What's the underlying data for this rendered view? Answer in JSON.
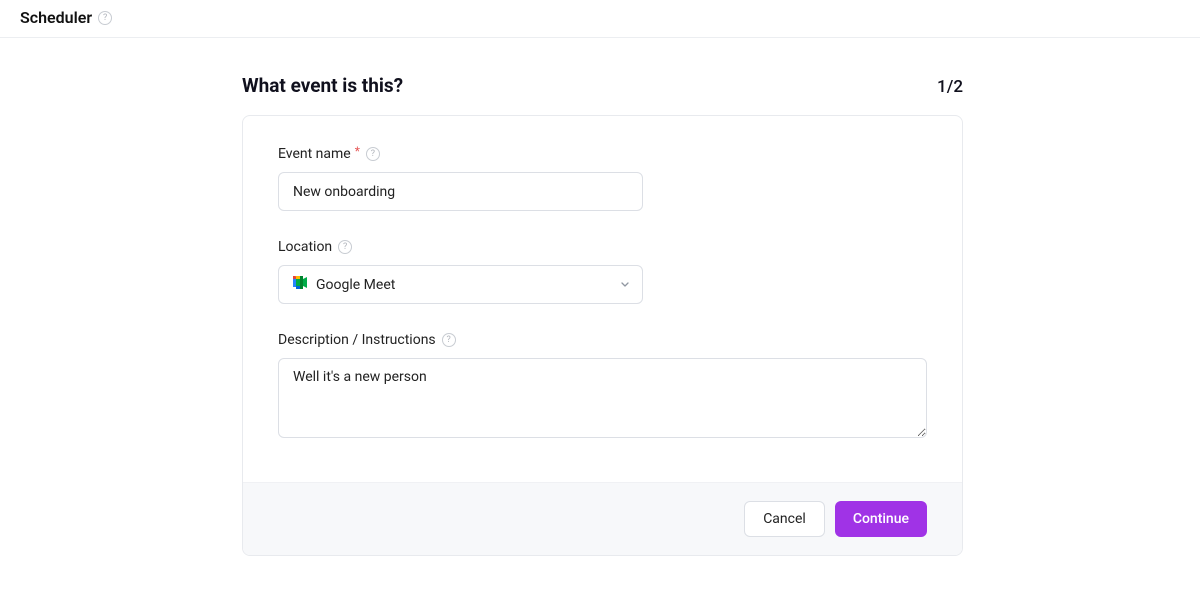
{
  "header": {
    "title": "Scheduler"
  },
  "form": {
    "heading": "What event is this?",
    "step": "1/2",
    "event_name": {
      "label": "Event name",
      "value": "New onboarding"
    },
    "location": {
      "label": "Location",
      "selected": "Google Meet"
    },
    "description": {
      "label": "Description / Instructions",
      "value": "Well it's a new person"
    },
    "buttons": {
      "cancel": "Cancel",
      "continue": "Continue"
    }
  }
}
